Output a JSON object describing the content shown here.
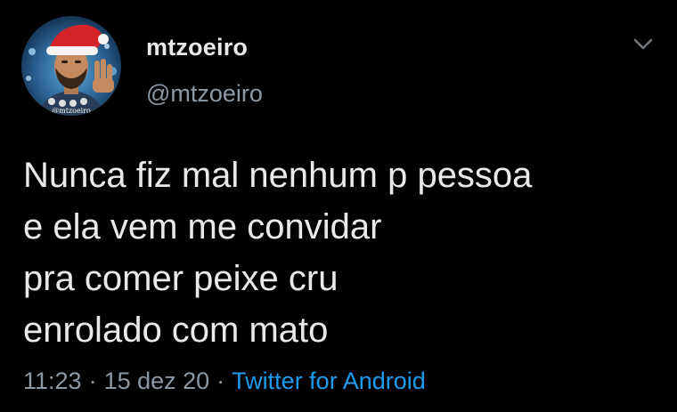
{
  "author": {
    "display_name": "mtzoeiro",
    "handle": "@mtzoeiro",
    "avatar_watermark": "@mtzoeiro"
  },
  "menu": {
    "icon": "chevron-down-icon"
  },
  "tweet": {
    "lines": [
      "Nunca fiz mal nenhum p pessoa",
      "e ela vem me convidar",
      "pra comer peixe cru",
      "enrolado com mato"
    ]
  },
  "meta": {
    "time": "11:23",
    "separator": "·",
    "date": "15 dez 20",
    "source": "Twitter for Android"
  },
  "colors": {
    "background": "#000000",
    "text": "#e7e9ea",
    "secondary": "#8b98a5",
    "link": "#1d9bf0"
  }
}
